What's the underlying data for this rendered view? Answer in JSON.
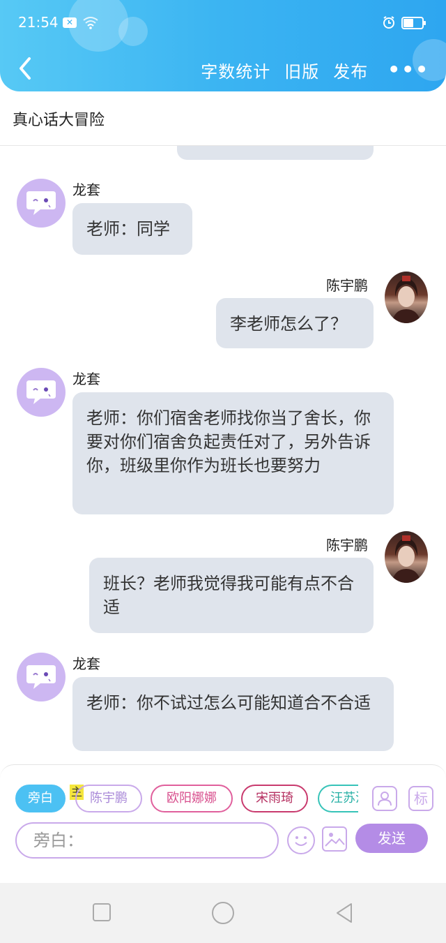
{
  "status_bar": {
    "time": "21:54",
    "notification_badge": "✕"
  },
  "header": {
    "back_icon": "chevron-left-icon",
    "actions": {
      "word_count": "字数统计",
      "old_version": "旧版",
      "publish": "发布",
      "more": "•••"
    },
    "gradient_colors": [
      "#57c9f5",
      "#2ea6f0"
    ]
  },
  "page": {
    "title": "真心话大冒险"
  },
  "messages": [
    {
      "sender": "龙套",
      "side": "left",
      "text": "老师：同学"
    },
    {
      "sender": "陈宇鹏",
      "side": "right",
      "text": "李老师怎么了？"
    },
    {
      "sender": "龙套",
      "side": "left",
      "text": "老师：你们宿舍老师找你当了舍长，你要对你们宿舍负起责任对了，另外告诉你，班级里你作为班长也要努力"
    },
    {
      "sender": "陈宇鹏",
      "side": "right",
      "text": "班长？老师我觉得我可能有点不合适"
    },
    {
      "sender": "龙套",
      "side": "left",
      "text": "老师：你不试过怎么可能知道合不合适"
    }
  ],
  "input_panel": {
    "role_chips": [
      {
        "label": "旁白",
        "active": true
      },
      {
        "label": "陈宇鹏",
        "color": "#c9a9ea"
      },
      {
        "label": "欧阳娜娜",
        "color": "#e05f9c"
      },
      {
        "label": "宋雨琦",
        "color": "#c93a6e"
      },
      {
        "label": "汪苏泷",
        "color": "#36c3b8"
      }
    ],
    "main_tag": "主",
    "mark_label": "标",
    "input_placeholder": "旁白：",
    "send_label": "发送"
  },
  "colors": {
    "bubble": "#dfe4ec",
    "accent_purple": "#b48ce6",
    "accent_blue": "#4cc1f3"
  }
}
